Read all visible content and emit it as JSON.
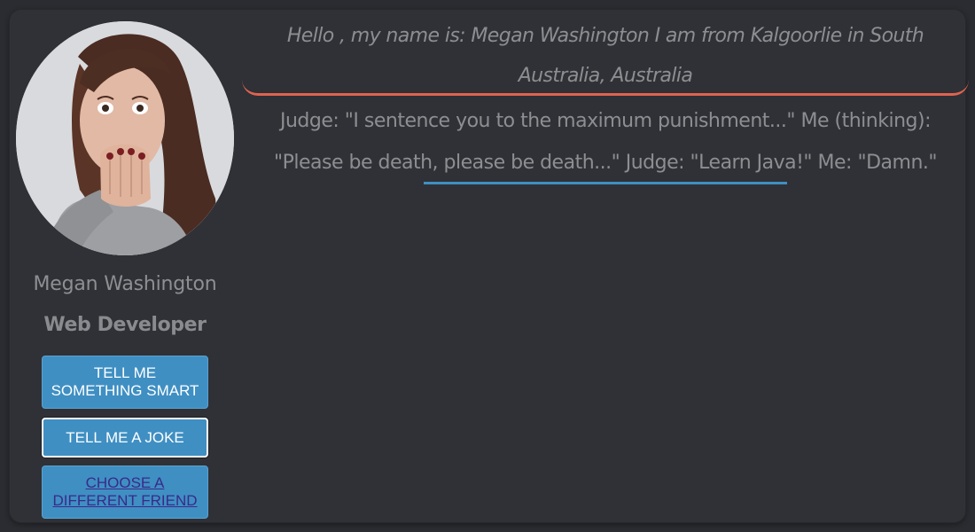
{
  "profile": {
    "name": "Megan Washington",
    "role": "Web Developer"
  },
  "greeting": {
    "text": "Hello , my name is: Megan Washington I am from Kalgoorlie in South Australia, Australia"
  },
  "message": {
    "text": "Judge: \"I sentence you to the maximum punishment...\" Me (thinking): \"Please be death, please be death...\" Judge: \"Learn Java!\" Me: \"Damn.\""
  },
  "buttons": {
    "smart": "TELL ME SOMETHING SMART",
    "joke": "TELL ME A JOKE",
    "friend": "CHOOSE A DIFFERENT FRIEND"
  },
  "colors": {
    "background": "#2a2c31",
    "card": "#2f3136",
    "text": "#8d8e92",
    "button": "#3f8fc3",
    "greeting_accent": "#e0634f",
    "message_accent": "#3f8fc3"
  }
}
